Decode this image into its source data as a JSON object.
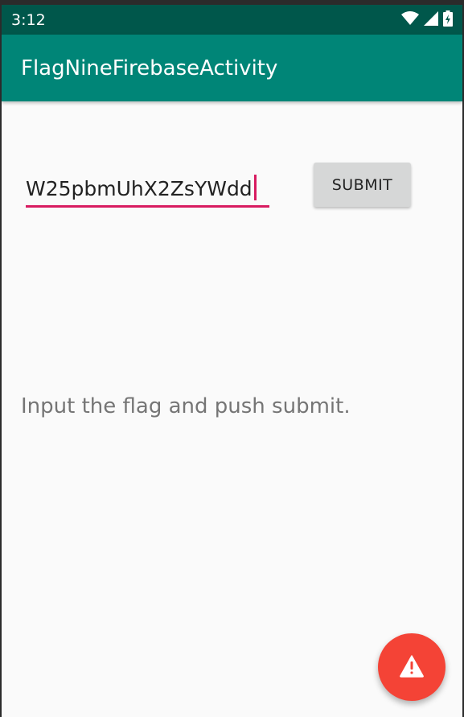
{
  "status_bar": {
    "time": "3:12",
    "icons": [
      "wifi-icon",
      "signal-icon",
      "battery-charging-icon"
    ]
  },
  "app_bar": {
    "title": "FlagNineFirebaseActivity",
    "color": "#008577"
  },
  "form": {
    "flag_value": "W25pbmUhX2ZsYWdd",
    "submit_label": "SUBMIT",
    "accent_color": "#d81b60"
  },
  "message": "Input the flag and push submit.",
  "fab": {
    "icon": "warning-icon",
    "color": "#f44336"
  }
}
